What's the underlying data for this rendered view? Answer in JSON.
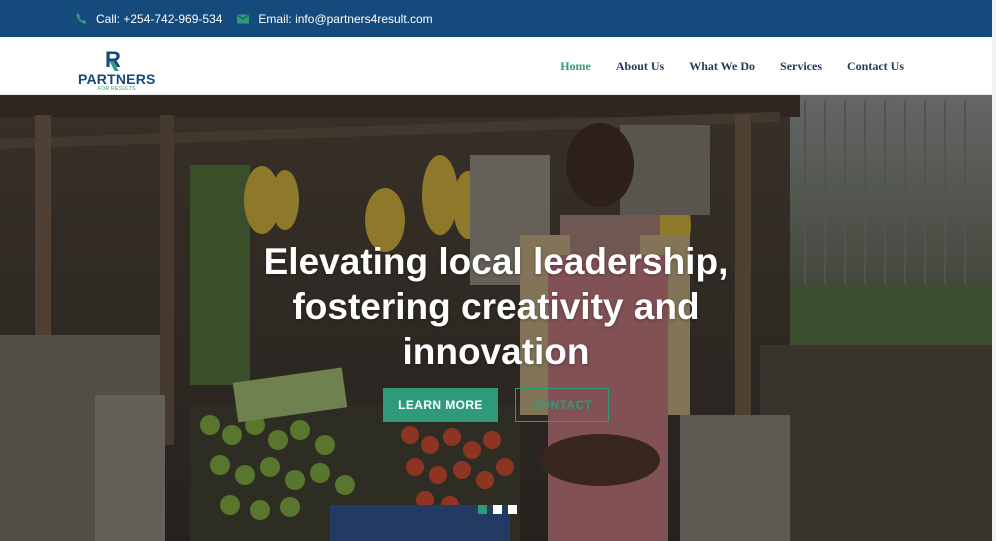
{
  "topbar": {
    "phone": "Call: +254-742-969-534",
    "email": "Email: info@partners4result.com",
    "phone_icon": "phone-icon",
    "email_icon": "envelope-icon"
  },
  "logo": {
    "mark": "R",
    "name": "PARTNERS",
    "tagline": "FOR RESULTS"
  },
  "nav": {
    "items": [
      {
        "label": "Home",
        "active": true
      },
      {
        "label": "About Us",
        "active": false
      },
      {
        "label": "What We Do",
        "active": false
      },
      {
        "label": "Services",
        "active": false
      },
      {
        "label": "Contact Us",
        "active": false
      }
    ]
  },
  "hero": {
    "headline_lines": [
      "Elevating local leadership,",
      "fostering creativity and",
      "innovation"
    ],
    "learn_more": "LEARN MORE",
    "contact": "CONTACT",
    "slides": 3,
    "active_slide": 0
  },
  "colors": {
    "topbar": "#154a7c",
    "accent": "#2f9a7a",
    "nav_text": "#1d3b5c"
  }
}
